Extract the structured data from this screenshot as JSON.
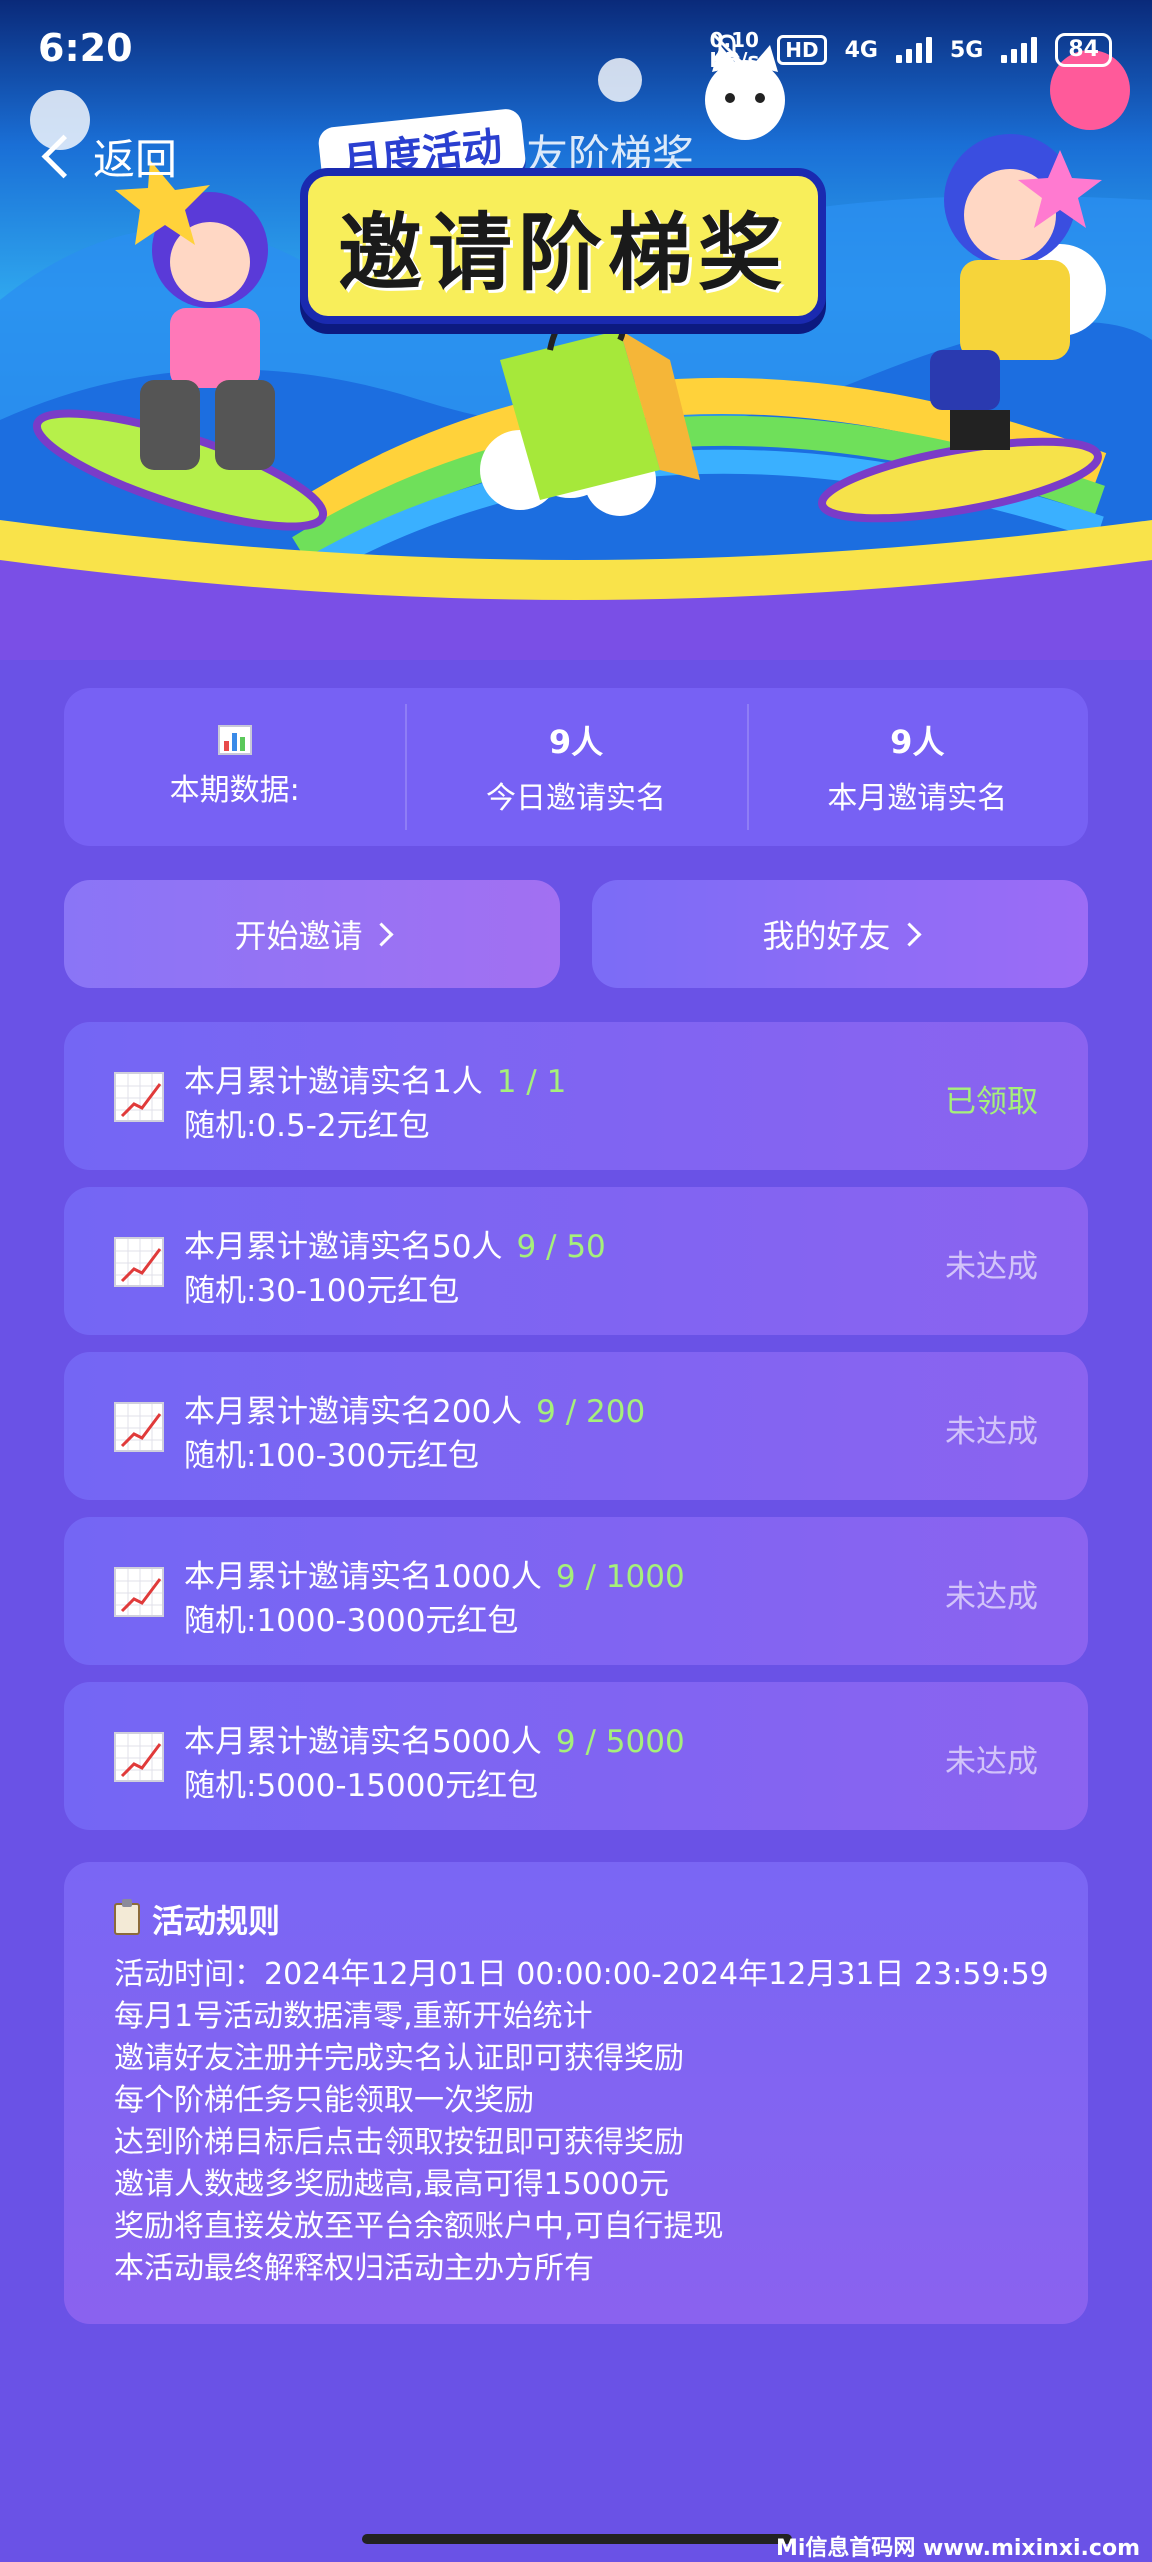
{
  "status_bar": {
    "time": "6:20",
    "net_speed_value": "0.10",
    "net_speed_unit": "KB/s",
    "hd_label": "HD",
    "net_type_1": "4G",
    "net_type_2": "5G",
    "battery": "84"
  },
  "header": {
    "back_label": "返回",
    "nav_title": "邀请好友阶梯奖",
    "badge": "月度活动",
    "banner_title": "邀请阶梯奖"
  },
  "stats": {
    "period_label": "本期数据:",
    "today_value": "9人",
    "today_label": "今日邀请实名",
    "month_value": "9人",
    "month_label": "本月邀请实名"
  },
  "actions": {
    "invite_label": "开始邀请",
    "friends_label": "我的好友"
  },
  "tiers": [
    {
      "title": "本月累计邀请实名1人",
      "progress": "1 / 1",
      "reward": "随机:0.5-2元红包",
      "status": "已领取"
    },
    {
      "title": "本月累计邀请实名50人",
      "progress": "9 / 50",
      "reward": "随机:30-100元红包",
      "status": "未达成"
    },
    {
      "title": "本月累计邀请实名200人",
      "progress": "9 / 200",
      "reward": "随机:100-300元红包",
      "status": "未达成"
    },
    {
      "title": "本月累计邀请实名1000人",
      "progress": "9 / 1000",
      "reward": "随机:1000-3000元红包",
      "status": "未达成"
    },
    {
      "title": "本月累计邀请实名5000人",
      "progress": "9 / 5000",
      "reward": "随机:5000-15000元红包",
      "status": "未达成"
    }
  ],
  "rules": {
    "title": "活动规则",
    "items": [
      "活动时间：2024年12月01日 00:00:00-2024年12月31日 23:59:59",
      "每月1号活动数据清零,重新开始统计",
      "邀请好友注册并完成实名认证即可获得奖励",
      "每个阶梯任务只能领取一次奖励",
      "达到阶梯目标后点击领取按钮即可获得奖励",
      "邀请人数越多奖励越高,最高可得15000元",
      "奖励将直接发放至平台余额账户中,可自行提现",
      "本活动最终解释权归活动主办方所有"
    ]
  },
  "watermark": "Mi信息首码网 www.mixinxi.com",
  "colors": {
    "background": "#6a52e6",
    "card": "#7a66f4",
    "progress_green": "#a6f07a",
    "title_yellow": "#f8ee5a"
  }
}
